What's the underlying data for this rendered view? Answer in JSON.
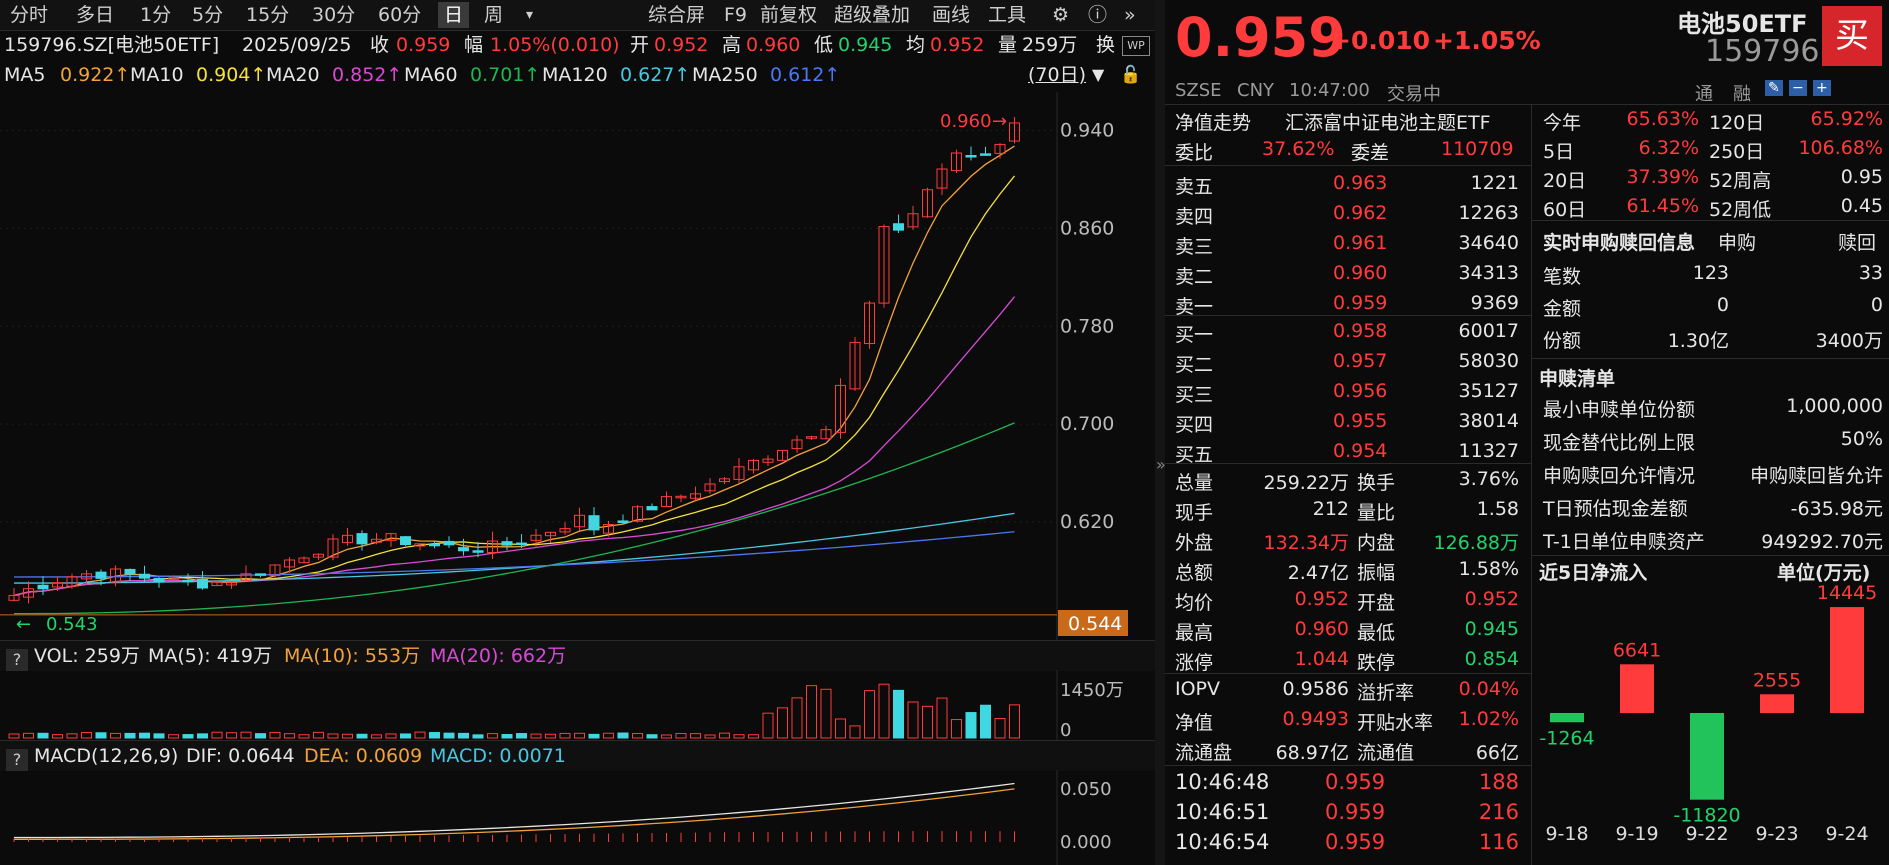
{
  "toolbar": {
    "tabs": [
      "分时",
      "多日",
      "1分",
      "5分",
      "15分",
      "30分",
      "60分",
      "日",
      "周"
    ],
    "active_tab": "日",
    "right_items": [
      "综合屏",
      "F9",
      "前复权",
      "超级叠加",
      "画线",
      "工具"
    ]
  },
  "info": {
    "code_name": "159796.SZ[电池50ETF]",
    "date": "2025/09/25",
    "close_label": "收",
    "close": "0.959",
    "change_label": "幅",
    "change": "1.05%(0.010)",
    "open_label": "开",
    "open": "0.952",
    "high_label": "高",
    "high": "0.960",
    "low_label": "低",
    "low": "0.945",
    "avg_label": "均",
    "avg": "0.952",
    "vol_label": "量",
    "vol": "259万",
    "turnover_label": "换"
  },
  "ma": {
    "ma5": "MA5",
    "ma5_val": "0.922↑",
    "ma10": "MA10",
    "ma10_val": "0.904↑",
    "ma20": "MA20",
    "ma20_val": "0.852↑",
    "ma60": "MA60",
    "ma60_val": "0.701↑",
    "ma120": "MA120",
    "ma120_val": "0.627↑",
    "ma250": "MA250",
    "ma250_val": "0.612↑",
    "period": "(70日)"
  },
  "chart_data": {
    "type": "candlestick",
    "y_ticks": [
      "0.940",
      "0.860",
      "0.780",
      "0.700",
      "0.620"
    ],
    "ylim": [
      0.53,
      0.965
    ],
    "high_label": "0.960",
    "low_label": "0.543",
    "current_price_tag": "0.544",
    "vol_ticks": [
      "1450万",
      "0"
    ],
    "macd_ticks": [
      "0.050",
      "0.000"
    ]
  },
  "volume": {
    "label": "VOL: 259万",
    "ma5": "MA(5): 419万",
    "ma10": "MA(10): 553万",
    "ma20": "MA(20): 662万"
  },
  "macd": {
    "label": "MACD(12,26,9)",
    "dif": "DIF: 0.0644",
    "dea": "DEA: 0.0609",
    "macd": "MACD: 0.0071"
  },
  "quote": {
    "price": "0.959",
    "change": "+0.010",
    "change_pct": "+1.05%",
    "name": "电池50ETF",
    "code": "159796",
    "buy": "买",
    "market": "SZSE",
    "currency": "CNY",
    "time": "10:47:00",
    "status": "交易中",
    "tong": "通",
    "rong": "融"
  },
  "fund": {
    "nav_label": "净值走势",
    "fund_name": "汇添富中证电池主题ETF",
    "weibi_label": "委比",
    "weibi": "37.62%",
    "weicha_label": "委差",
    "weicha": "110709"
  },
  "asks": [
    {
      "label": "卖五",
      "price": "0.963",
      "vol": "1221"
    },
    {
      "label": "卖四",
      "price": "0.962",
      "vol": "12263"
    },
    {
      "label": "卖三",
      "price": "0.961",
      "vol": "34640"
    },
    {
      "label": "卖二",
      "price": "0.960",
      "vol": "34313"
    },
    {
      "label": "卖一",
      "price": "0.959",
      "vol": "9369"
    }
  ],
  "bids": [
    {
      "label": "买一",
      "price": "0.958",
      "vol": "60017"
    },
    {
      "label": "买二",
      "price": "0.957",
      "vol": "58030"
    },
    {
      "label": "买三",
      "price": "0.956",
      "vol": "35127"
    },
    {
      "label": "买四",
      "price": "0.955",
      "vol": "38014"
    },
    {
      "label": "买五",
      "price": "0.954",
      "vol": "11327"
    }
  ],
  "stats": [
    {
      "l1": "总量",
      "v1": "259.22万",
      "c1": "white",
      "l2": "换手",
      "v2": "3.76%",
      "c2": "white"
    },
    {
      "l1": "现手",
      "v1": "212",
      "c1": "white",
      "l2": "量比",
      "v2": "1.58",
      "c2": "white"
    },
    {
      "l1": "外盘",
      "v1": "132.34万",
      "c1": "red",
      "l2": "内盘",
      "v2": "126.88万",
      "c2": "green"
    },
    {
      "l1": "总额",
      "v1": "2.47亿",
      "c1": "white",
      "l2": "振幅",
      "v2": "1.58%",
      "c2": "white"
    },
    {
      "l1": "均价",
      "v1": "0.952",
      "c1": "red",
      "l2": "开盘",
      "v2": "0.952",
      "c2": "red"
    },
    {
      "l1": "最高",
      "v1": "0.960",
      "c1": "red",
      "l2": "最低",
      "v2": "0.945",
      "c2": "green"
    },
    {
      "l1": "涨停",
      "v1": "1.044",
      "c1": "red",
      "l2": "跌停",
      "v2": "0.854",
      "c2": "green"
    }
  ],
  "stats2": [
    {
      "l1": "IOPV",
      "v1": "0.9586",
      "c1": "white",
      "l2": "溢折率",
      "v2": "0.04%",
      "c2": "red"
    },
    {
      "l1": "净值",
      "v1": "0.9493",
      "c1": "red",
      "l2": "开贴水率",
      "v2": "1.02%",
      "c2": "red"
    },
    {
      "l1": "流通盘",
      "v1": "68.97亿",
      "c1": "white",
      "l2": "流通值",
      "v2": "66亿",
      "c2": "white"
    }
  ],
  "ticks": [
    {
      "time": "10:46:48",
      "price": "0.959",
      "vol": "188"
    },
    {
      "time": "10:46:51",
      "price": "0.959",
      "vol": "216"
    },
    {
      "time": "10:46:54",
      "price": "0.959",
      "vol": "116"
    }
  ],
  "perf": [
    {
      "l1": "今年",
      "v1": "65.63%",
      "l2": "120日",
      "v2": "65.92%",
      "c2": "red"
    },
    {
      "l1": "5日",
      "v1": "6.32%",
      "l2": "250日",
      "v2": "106.68%",
      "c2": "red"
    },
    {
      "l1": "20日",
      "v1": "37.39%",
      "l2": "52周高",
      "v2": "0.95",
      "c2": "white"
    },
    {
      "l1": "60日",
      "v1": "61.45%",
      "l2": "52周低",
      "v2": "0.45",
      "c2": "white"
    }
  ],
  "subscribe": {
    "title": "实时申购赎回信息",
    "col1": "申购",
    "col2": "赎回",
    "rows": [
      {
        "label": "笔数",
        "v1": "123",
        "v2": "33"
      },
      {
        "label": "金额",
        "v1": "0",
        "v2": "0"
      },
      {
        "label": "份额",
        "v1": "1.30亿",
        "v2": "3400万"
      }
    ]
  },
  "list": {
    "title": "申赎清单",
    "rows": [
      {
        "label": "最小申赎单位份额",
        "value": "1,000,000"
      },
      {
        "label": "现金替代比例上限",
        "value": "50%"
      },
      {
        "label": "申购赎回允许情况",
        "value": "申购赎回皆允许"
      },
      {
        "label": "T日预估现金差额",
        "value": "-635.98元"
      },
      {
        "label": "T-1日单位申赎资产",
        "value": "949292.70元"
      }
    ]
  },
  "netflow": {
    "title": "近5日净流入",
    "unit": "单位(万元)",
    "dates": [
      "9-18",
      "9-19",
      "9-22",
      "9-23",
      "9-24"
    ],
    "values": [
      -1264,
      6641,
      -11820,
      2555,
      14445
    ],
    "labels": [
      "-1264",
      "6641",
      "-11820",
      "2555",
      "14445"
    ]
  }
}
